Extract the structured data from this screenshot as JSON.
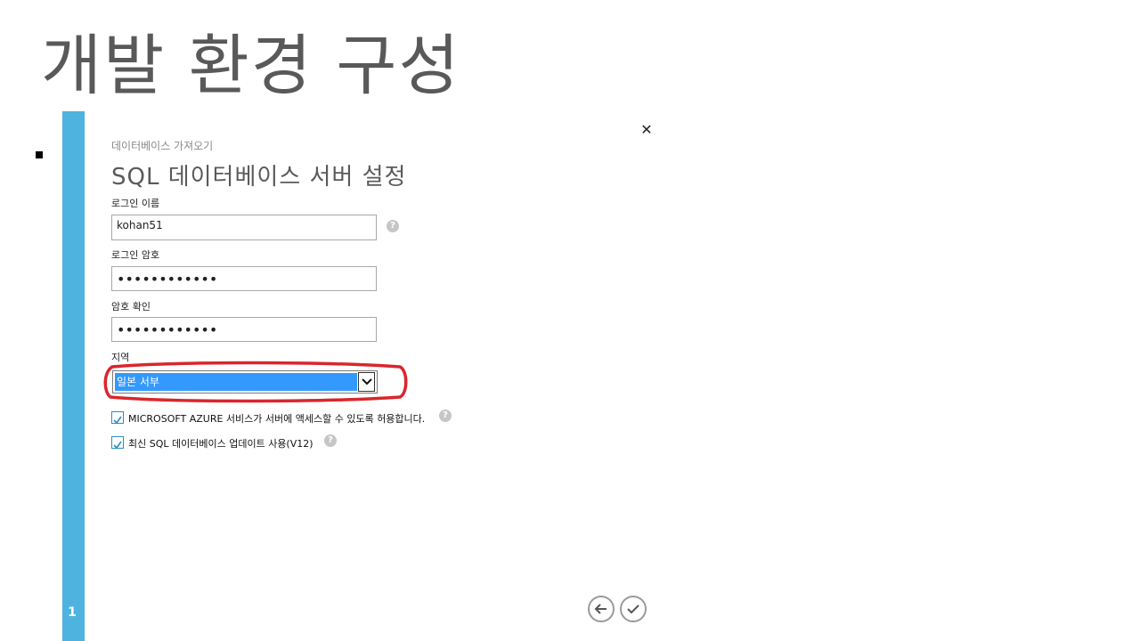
{
  "slide": {
    "title": "개발 환경 구성",
    "page_number": "1"
  },
  "dialog": {
    "subtitle": "데이터베이스 가져오기",
    "title": "SQL 데이터베이스 서버 설정",
    "login_name_label": "로그인 이름",
    "login_name_value": "kohan51",
    "login_password_label": "로그인 암호",
    "login_password_value": "••••••••••••",
    "confirm_password_label": "암호 확인",
    "confirm_password_value": "••••••••••••",
    "region_label": "지역",
    "region_value": "일본 서부",
    "allow_azure_label": "MICROSOFT AZURE 서비스가 서버에 액세스할 수 있도록 허용합니다.",
    "allow_azure_checked": true,
    "latest_sql_label": "최신 SQL 데이터베이스 업데이트 사용(V12)",
    "latest_sql_checked": true
  },
  "icons": {
    "close": "close-icon",
    "help": "help-icon",
    "back": "arrow-left-icon",
    "confirm": "checkmark-icon",
    "dropdown": "chevron-down-icon"
  },
  "colors": {
    "accent_bar": "#4eb3df",
    "selection": "#3399ff",
    "highlight_ellipse": "#d9262c",
    "checkbox_border": "#2b8ec5"
  }
}
